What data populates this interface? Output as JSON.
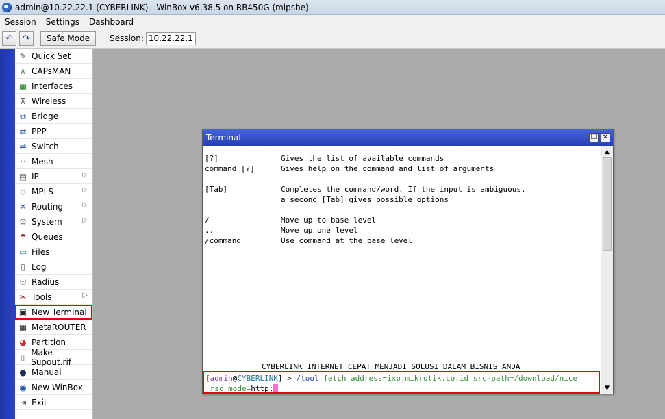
{
  "window": {
    "title": "admin@10.22.22.1 (CYBERLINK) - WinBox v6.38.5 on RB450G (mipsbe)"
  },
  "menubar": [
    "Session",
    "Settings",
    "Dashboard"
  ],
  "toolbar": {
    "undo_icon": "undo-icon",
    "redo_icon": "redo-icon",
    "safe_mode": "Safe Mode",
    "session_label": "Session:",
    "session_value": "10.22.22.1"
  },
  "sidebar": {
    "items": [
      {
        "label": "Quick Set",
        "icon": "quick-set-icon",
        "glyph": "✎",
        "color": "#555555",
        "submenu": false
      },
      {
        "label": "CAPsMAN",
        "icon": "capsman-icon",
        "glyph": "⊼",
        "color": "#4b7a4b",
        "submenu": false
      },
      {
        "label": "Interfaces",
        "icon": "interfaces-icon",
        "glyph": "▦",
        "color": "#2e8b2e",
        "submenu": false
      },
      {
        "label": "Wireless",
        "icon": "wireless-icon",
        "glyph": "⊼",
        "color": "#5a5a5a",
        "submenu": false
      },
      {
        "label": "Bridge",
        "icon": "bridge-icon",
        "glyph": "⧉",
        "color": "#2a5db0",
        "submenu": false
      },
      {
        "label": "PPP",
        "icon": "ppp-icon",
        "glyph": "⇄",
        "color": "#2a5db0",
        "submenu": false
      },
      {
        "label": "Switch",
        "icon": "switch-icon",
        "glyph": "⇌",
        "color": "#2a5db0",
        "submenu": false
      },
      {
        "label": "Mesh",
        "icon": "mesh-icon",
        "glyph": "⁘",
        "color": "#2a5db0",
        "submenu": false
      },
      {
        "label": "IP",
        "icon": "ip-icon",
        "glyph": "▤",
        "color": "#666666",
        "submenu": true
      },
      {
        "label": "MPLS",
        "icon": "mpls-icon",
        "glyph": "◇",
        "color": "#888888",
        "submenu": true
      },
      {
        "label": "Routing",
        "icon": "routing-icon",
        "glyph": "✕",
        "color": "#2a5db0",
        "submenu": true
      },
      {
        "label": "System",
        "icon": "system-icon",
        "glyph": "⚙",
        "color": "#777777",
        "submenu": true
      },
      {
        "label": "Queues",
        "icon": "queues-icon",
        "glyph": "☂",
        "color": "#8a3a2a",
        "submenu": false
      },
      {
        "label": "Files",
        "icon": "files-icon",
        "glyph": "▭",
        "color": "#3b8fd0",
        "submenu": false
      },
      {
        "label": "Log",
        "icon": "log-icon",
        "glyph": "▯",
        "color": "#666666",
        "submenu": false
      },
      {
        "label": "Radius",
        "icon": "radius-icon",
        "glyph": "☉",
        "color": "#555555",
        "submenu": false
      },
      {
        "label": "Tools",
        "icon": "tools-icon",
        "glyph": "✂",
        "color": "#a02020",
        "submenu": true
      },
      {
        "label": "New Terminal",
        "icon": "terminal-icon",
        "glyph": "▣",
        "color": "#222222",
        "submenu": false,
        "highlight": true
      },
      {
        "label": "MetaROUTER",
        "icon": "metarouter-icon",
        "glyph": "▦",
        "color": "#333333",
        "submenu": false
      },
      {
        "label": "Partition",
        "icon": "partition-icon",
        "glyph": "◕",
        "color": "#d03030",
        "submenu": false
      },
      {
        "label": "Make Supout.rif",
        "icon": "supout-icon",
        "glyph": "▯",
        "color": "#666666",
        "submenu": false
      },
      {
        "label": "Manual",
        "icon": "manual-icon",
        "glyph": "●",
        "color": "#1f2f5a",
        "submenu": false
      },
      {
        "label": "New WinBox",
        "icon": "winbox-icon",
        "glyph": "◉",
        "color": "#1f5aa8",
        "submenu": false
      },
      {
        "label": "Exit",
        "icon": "exit-icon",
        "glyph": "⇥",
        "color": "#555555",
        "submenu": false
      }
    ]
  },
  "terminal": {
    "title": "Terminal",
    "help": [
      {
        "key": "[?]",
        "desc": "Gives the list of available commands"
      },
      {
        "key": "command [?]",
        "desc": "Gives help on the command and list of arguments"
      },
      {
        "key": "",
        "desc": ""
      },
      {
        "key": "[Tab]",
        "desc": "Completes the command/word. If the input is ambiguous,"
      },
      {
        "key": "",
        "desc": "a second [Tab] gives possible options"
      },
      {
        "key": "",
        "desc": ""
      },
      {
        "key": "/",
        "desc": "Move up to base level"
      },
      {
        "key": "..",
        "desc": "Move up one level"
      },
      {
        "key": "/command",
        "desc": "Use command at the base level"
      }
    ],
    "banner": "CYBERLINK INTERNET CEPAT MENJADI SOLUSI DALAM BISNIS ANDA",
    "prompt": {
      "open": "[",
      "user": "admin",
      "at": "@",
      "host": "CYBERLINK",
      "close": "] > ",
      "path": "/tool",
      "command": "fetch",
      "line2_param": "mode=",
      "line2_value": "http;"
    },
    "cmd_line1_rest": " address=ixp.mikrotik.co.id src-path=/download/nice",
    "cmd_line2_start": ".rsc "
  }
}
